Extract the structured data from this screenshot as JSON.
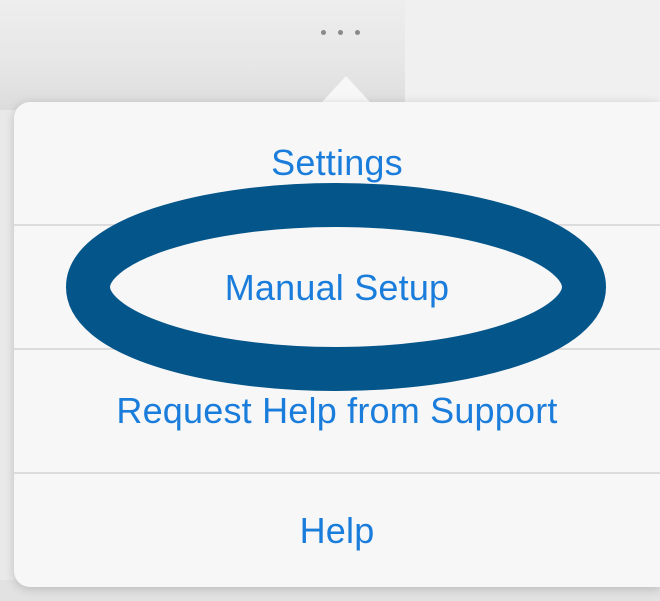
{
  "menu": {
    "items": [
      {
        "label": "Settings"
      },
      {
        "label": "Manual Setup"
      },
      {
        "label": "Request Help from Support"
      },
      {
        "label": "Help"
      }
    ]
  },
  "toolbar": {
    "more_icon": "ellipsis-icon"
  },
  "colors": {
    "link_blue": "#1a7ddb",
    "highlight_ring": "#04558a",
    "popover_bg": "#f7f7f7"
  }
}
